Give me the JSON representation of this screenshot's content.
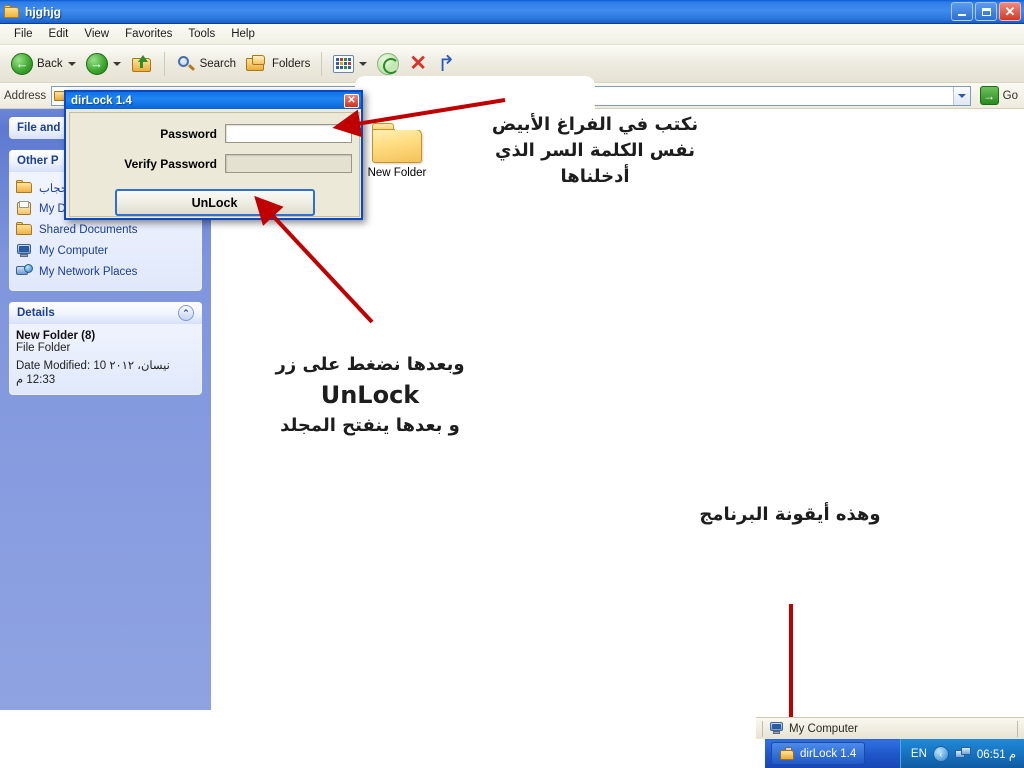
{
  "window": {
    "title": "hjghjg",
    "icon": "folder-icon",
    "controls": {
      "minimize": "_",
      "maximize": "❐",
      "close": "✕"
    }
  },
  "menubar": {
    "items": [
      "File",
      "Edit",
      "View",
      "Favorites",
      "Tools",
      "Help"
    ]
  },
  "toolbar": {
    "back_label": "Back",
    "forward_label": "",
    "up_label": "",
    "search_label": "Search",
    "folders_label": "Folders",
    "views_label": "",
    "icons": [
      "back-arrow-icon",
      "forward-arrow-icon",
      "up-folder-icon",
      "search-icon",
      "folders-icon",
      "views-icon",
      "sync-icon",
      "delete-icon",
      "undo-icon"
    ]
  },
  "address": {
    "label": "Address",
    "value": "",
    "go_label": "Go"
  },
  "sidebar": {
    "file_panel": {
      "title": "File and"
    },
    "other_places": {
      "title": "Other P",
      "items": [
        {
          "label": "حجاب",
          "icon": "folder-icon"
        },
        {
          "label": "My Documents",
          "icon": "documents-icon"
        },
        {
          "label": "Shared Documents",
          "icon": "folder-icon"
        },
        {
          "label": "My Computer",
          "icon": "computer-icon"
        },
        {
          "label": "My Network Places",
          "icon": "network-icon"
        }
      ]
    },
    "details": {
      "title": "Details",
      "collapse_icon": "chevron-up-icon",
      "name": "New Folder (8)",
      "type": "File Folder",
      "date_modified": "Date Modified: 10 نيسان، ٢٠١٢ 12:33 م"
    }
  },
  "content": {
    "files": [
      {
        "label": "New Folder (8)",
        "icon": "folder-icon"
      },
      {
        "label": "New Folder",
        "icon": "folder-icon"
      }
    ]
  },
  "dialog": {
    "title": "dirLock 1.4",
    "close_label": "✕",
    "password_label": "Password",
    "password_value": "",
    "verify_label": "Verify Password",
    "verify_value": "",
    "unlock_button": "UnLock"
  },
  "annotations": {
    "top": "نكتب في الفراغ الأبيض نفس الكلمة السر الذي أدخلناها",
    "middle_line1": "وبعدها نضغط على زر",
    "middle_emphasis": "UnLock",
    "middle_line2": "و بعدها ينفتح المجلد",
    "bottom": "وهذه أيقونة البرنامج",
    "arrow_color": "#c00000"
  },
  "secondary_bar": {
    "item_label": "My Computer",
    "item_icon": "computer-icon"
  },
  "taskbar": {
    "task_label": "dirLock 1.4",
    "task_icon": "dirlock-icon",
    "language": "EN",
    "tray_icons": [
      "show-hidden-icons-icon",
      "network-icon"
    ],
    "clock": "06:51 م"
  },
  "colors": {
    "titlebar_blue": "#2f7ee8",
    "sidebar_blue": "#7f96dd",
    "dialog_face": "#ece9d8",
    "accent_red": "#c00000"
  }
}
